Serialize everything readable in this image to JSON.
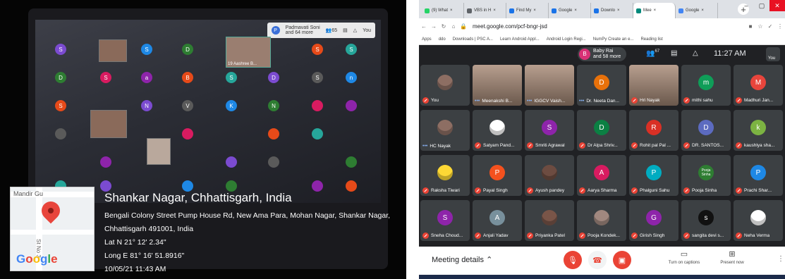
{
  "left_photo": {
    "laptop_screen": {
      "header_name": "Padmavati Soni",
      "header_more": "and 64 more",
      "header_count": "65",
      "you_label": "You",
      "video_name": "19 Aashree B...",
      "tiles": [
        "S",
        "S",
        "D",
        "D",
        "S",
        "S",
        "D",
        "S",
        "a",
        "B",
        "S",
        "D",
        "S",
        "n",
        "S",
        "N",
        "V",
        "K",
        "N"
      ]
    },
    "location": {
      "city": "Shankar Nagar, Chhattisgarh, India",
      "address_line1": "Bengali Colony Street Pump House Rd, New Ama Para, Mohan Nagar, Shankar Nagar,",
      "address_line2": "Chhattisgarh 491001, India",
      "lat": "Lat N 21° 12' 2.34\"",
      "long": "Long E 81° 16' 51.8916\"",
      "datetime": "10/05/21 11:43 AM",
      "map_brand": "Google",
      "map_label": "Mandir Gu",
      "map_street": "St No 3"
    }
  },
  "browser": {
    "tabs": [
      {
        "label": "(9) What",
        "color": "#25d366"
      },
      {
        "label": "VBS in H",
        "color": "#5f6368"
      },
      {
        "label": "Find My",
        "color": "#1a73e8"
      },
      {
        "label": "Google",
        "color": "#1a73e8"
      },
      {
        "label": "Downlo",
        "color": "#1a73e8"
      },
      {
        "label": "Mee",
        "color": "#00897b"
      },
      {
        "label": "Google",
        "color": "#4285f4"
      }
    ],
    "url": "meet.google.com/pcf-bngr-jsd",
    "bookmarks": [
      "Apps",
      "ddo",
      "Downloads | PSC A...",
      "Learn Android Appl...",
      "Android Login Regi...",
      "NumPy Create an e...",
      "Reading list"
    ]
  },
  "meet": {
    "pill_name": "Baby Rai",
    "pill_more": "and 58 more",
    "pill_initial": "B",
    "participants_count": "67",
    "time": "11:27 AM",
    "you_label": "You",
    "participants": [
      {
        "name": "You",
        "initial": "",
        "color": "#8d6e63",
        "video": false,
        "muted": true,
        "photo": true
      },
      {
        "name": "Meenakshi B...",
        "initial": "",
        "color": "",
        "video": true,
        "muted": false,
        "photo": false
      },
      {
        "name": "IGGCV Vaish...",
        "initial": "",
        "color": "",
        "video": true,
        "muted": false,
        "photo": false
      },
      {
        "name": "Dr. Neeta Dan...",
        "initial": "D",
        "color": "#e8710a",
        "video": false,
        "muted": false,
        "photo": false
      },
      {
        "name": "Hri Nayak",
        "initial": "",
        "color": "",
        "video": true,
        "muted": true,
        "photo": false
      },
      {
        "name": "mithi sahu",
        "initial": "m",
        "color": "#0f9d58",
        "video": false,
        "muted": true,
        "photo": false
      },
      {
        "name": "Madhuri Jan...",
        "initial": "M",
        "color": "#e8453c",
        "video": false,
        "muted": true,
        "photo": false
      },
      {
        "name": "HC Nayak",
        "initial": "",
        "color": "#8d6e63",
        "video": false,
        "muted": false,
        "photo": true
      },
      {
        "name": "Satyam Pand...",
        "initial": "",
        "color": "#fff",
        "video": false,
        "muted": true,
        "photo": true
      },
      {
        "name": "Smriti Agrawal",
        "initial": "S",
        "color": "#8e24aa",
        "video": false,
        "muted": true,
        "photo": false
      },
      {
        "name": "Dr Alpa Shriv...",
        "initial": "D",
        "color": "#0b8043",
        "video": false,
        "muted": true,
        "photo": false
      },
      {
        "name": "Rohit pal Pal ...",
        "initial": "R",
        "color": "#d93025",
        "video": false,
        "muted": true,
        "photo": false
      },
      {
        "name": "DR. SANTOS...",
        "initial": "D",
        "color": "#5c6bc0",
        "video": false,
        "muted": true,
        "photo": false
      },
      {
        "name": "kaushlya sha...",
        "initial": "k",
        "color": "#7cb342",
        "video": false,
        "muted": true,
        "photo": false
      },
      {
        "name": "Raksha Tiwari",
        "initial": "",
        "color": "#fdd835",
        "video": false,
        "muted": true,
        "photo": true
      },
      {
        "name": "Payal Singh",
        "initial": "P",
        "color": "#f4511e",
        "video": false,
        "muted": true,
        "photo": false
      },
      {
        "name": "Ayush pandey",
        "initial": "",
        "color": "#6d4c41",
        "video": false,
        "muted": true,
        "photo": true
      },
      {
        "name": "Aarya Sharma",
        "initial": "A",
        "color": "#d81b60",
        "video": false,
        "muted": true,
        "photo": false
      },
      {
        "name": "Phalguni Sahu",
        "initial": "P",
        "color": "#00acc1",
        "video": false,
        "muted": true,
        "photo": false
      },
      {
        "name": "Pooja Sinha",
        "initial": "Pooja Sinha",
        "color": "#2e7d32",
        "video": false,
        "muted": true,
        "photo": false
      },
      {
        "name": "Prachi Shar...",
        "initial": "P",
        "color": "#1e88e5",
        "video": false,
        "muted": true,
        "photo": false
      },
      {
        "name": "Sneha Choud...",
        "initial": "S",
        "color": "#8e24aa",
        "video": false,
        "muted": true,
        "photo": false
      },
      {
        "name": "Anjali Yadav",
        "initial": "A",
        "color": "#78909c",
        "video": false,
        "muted": true,
        "photo": false
      },
      {
        "name": "Priyanka Patel",
        "initial": "",
        "color": "#795548",
        "video": false,
        "muted": true,
        "photo": true
      },
      {
        "name": "Pooja Kondek...",
        "initial": "",
        "color": "#a1887f",
        "video": false,
        "muted": true,
        "photo": true
      },
      {
        "name": "Girish Singh",
        "initial": "G",
        "color": "#8e24aa",
        "video": false,
        "muted": true,
        "photo": false
      },
      {
        "name": "sangita devi s...",
        "initial": "s",
        "color": "#111",
        "video": false,
        "muted": true,
        "photo": false
      },
      {
        "name": "Neha Verma",
        "initial": "",
        "color": "#fff",
        "video": false,
        "muted": true,
        "photo": true
      }
    ],
    "bottom": {
      "meeting_details": "Meeting details",
      "captions": "Turn on captions",
      "present": "Present now"
    }
  }
}
